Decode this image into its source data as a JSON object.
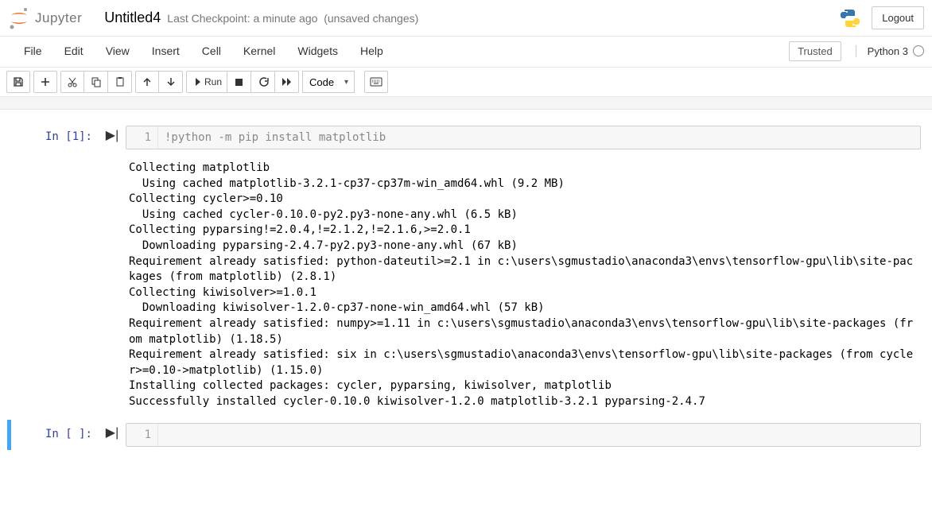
{
  "header": {
    "logo_text": "Jupyter",
    "title": "Untitled4",
    "checkpoint": "Last Checkpoint: a minute ago",
    "unsaved": "(unsaved changes)",
    "logout": "Logout"
  },
  "menubar": {
    "items": [
      "File",
      "Edit",
      "View",
      "Insert",
      "Cell",
      "Kernel",
      "Widgets",
      "Help"
    ],
    "trusted": "Trusted",
    "kernel": "Python 3"
  },
  "toolbar": {
    "run_label": "Run",
    "celltype": "Code"
  },
  "cells": [
    {
      "prompt": "In [1]:",
      "line_no": "1",
      "code": "!python -m pip install matplotlib",
      "output": "Collecting matplotlib\n  Using cached matplotlib-3.2.1-cp37-cp37m-win_amd64.whl (9.2 MB)\nCollecting cycler>=0.10\n  Using cached cycler-0.10.0-py2.py3-none-any.whl (6.5 kB)\nCollecting pyparsing!=2.0.4,!=2.1.2,!=2.1.6,>=2.0.1\n  Downloading pyparsing-2.4.7-py2.py3-none-any.whl (67 kB)\nRequirement already satisfied: python-dateutil>=2.1 in c:\\users\\sgmustadio\\anaconda3\\envs\\tensorflow-gpu\\lib\\site-packages (from matplotlib) (2.8.1)\nCollecting kiwisolver>=1.0.1\n  Downloading kiwisolver-1.2.0-cp37-none-win_amd64.whl (57 kB)\nRequirement already satisfied: numpy>=1.11 in c:\\users\\sgmustadio\\anaconda3\\envs\\tensorflow-gpu\\lib\\site-packages (from matplotlib) (1.18.5)\nRequirement already satisfied: six in c:\\users\\sgmustadio\\anaconda3\\envs\\tensorflow-gpu\\lib\\site-packages (from cycler>=0.10->matplotlib) (1.15.0)\nInstalling collected packages: cycler, pyparsing, kiwisolver, matplotlib\nSuccessfully installed cycler-0.10.0 kiwisolver-1.2.0 matplotlib-3.2.1 pyparsing-2.4.7"
    },
    {
      "prompt": "In [ ]:",
      "line_no": "1",
      "code": "",
      "output": null
    }
  ]
}
